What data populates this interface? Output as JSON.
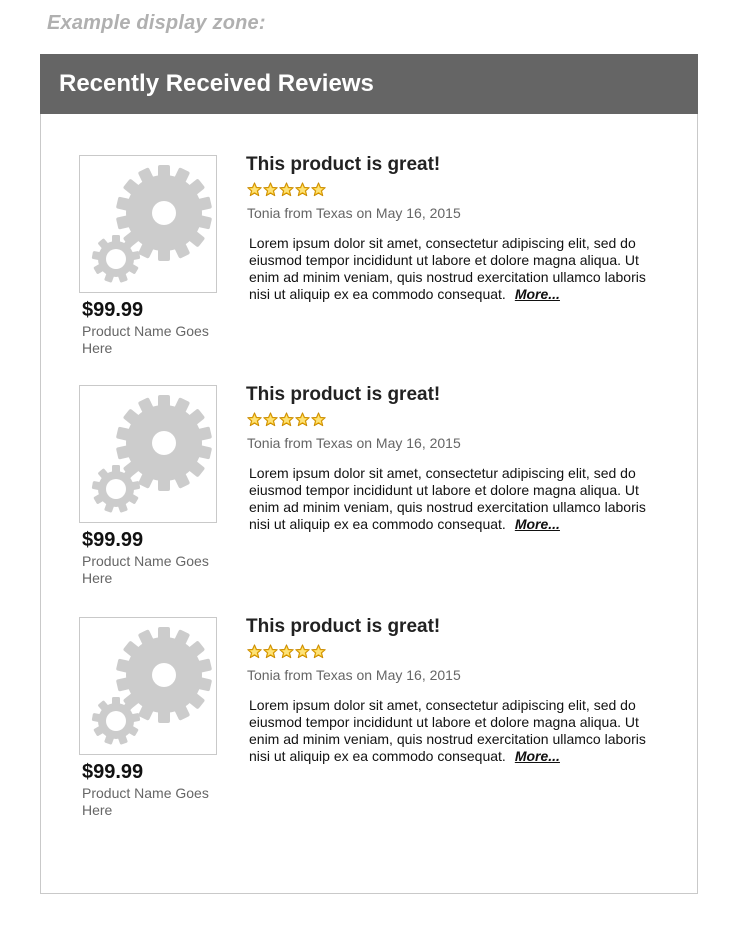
{
  "zone_label": "Example display zone:",
  "panel": {
    "title": "Recently Received Reviews"
  },
  "colors": {
    "header_bg": "#656565",
    "star": "#f5b400",
    "gear": "#cccccc"
  },
  "reviews": [
    {
      "product_image_icon": "gear-icon",
      "price": "$99.99",
      "product_name": "Product Name Goes Here",
      "title": "This product is great!",
      "rating": 5,
      "rating_max": 5,
      "byline": "Tonia from Texas on May 16, 2015",
      "body": "Lorem ipsum dolor sit amet, consectetur adipiscing elit, sed do eiusmod tempor incididunt ut labore et dolore magna aliqua. Ut enim ad minim veniam, quis nostrud exercitation ullamco laboris nisi ut aliquip ex ea commodo consequat.",
      "more_label": "More..."
    },
    {
      "product_image_icon": "gear-icon",
      "price": "$99.99",
      "product_name": "Product Name Goes Here",
      "title": "This product is great!",
      "rating": 5,
      "rating_max": 5,
      "byline": "Tonia from Texas on May 16, 2015",
      "body": "Lorem ipsum dolor sit amet, consectetur adipiscing elit, sed do eiusmod tempor incididunt ut labore et dolore magna aliqua. Ut enim ad minim veniam, quis nostrud exercitation ullamco laboris nisi ut aliquip ex ea commodo consequat.",
      "more_label": "More..."
    },
    {
      "product_image_icon": "gear-icon",
      "price": "$99.99",
      "product_name": "Product Name Goes Here",
      "title": "This product is great!",
      "rating": 5,
      "rating_max": 5,
      "byline": "Tonia from Texas on May 16, 2015",
      "body": "Lorem ipsum dolor sit amet, consectetur adipiscing elit, sed do eiusmod tempor incididunt ut labore et dolore magna aliqua. Ut enim ad minim veniam, quis nostrud exercitation ullamco laboris nisi ut aliquip ex ea commodo consequat.",
      "more_label": "More..."
    }
  ]
}
